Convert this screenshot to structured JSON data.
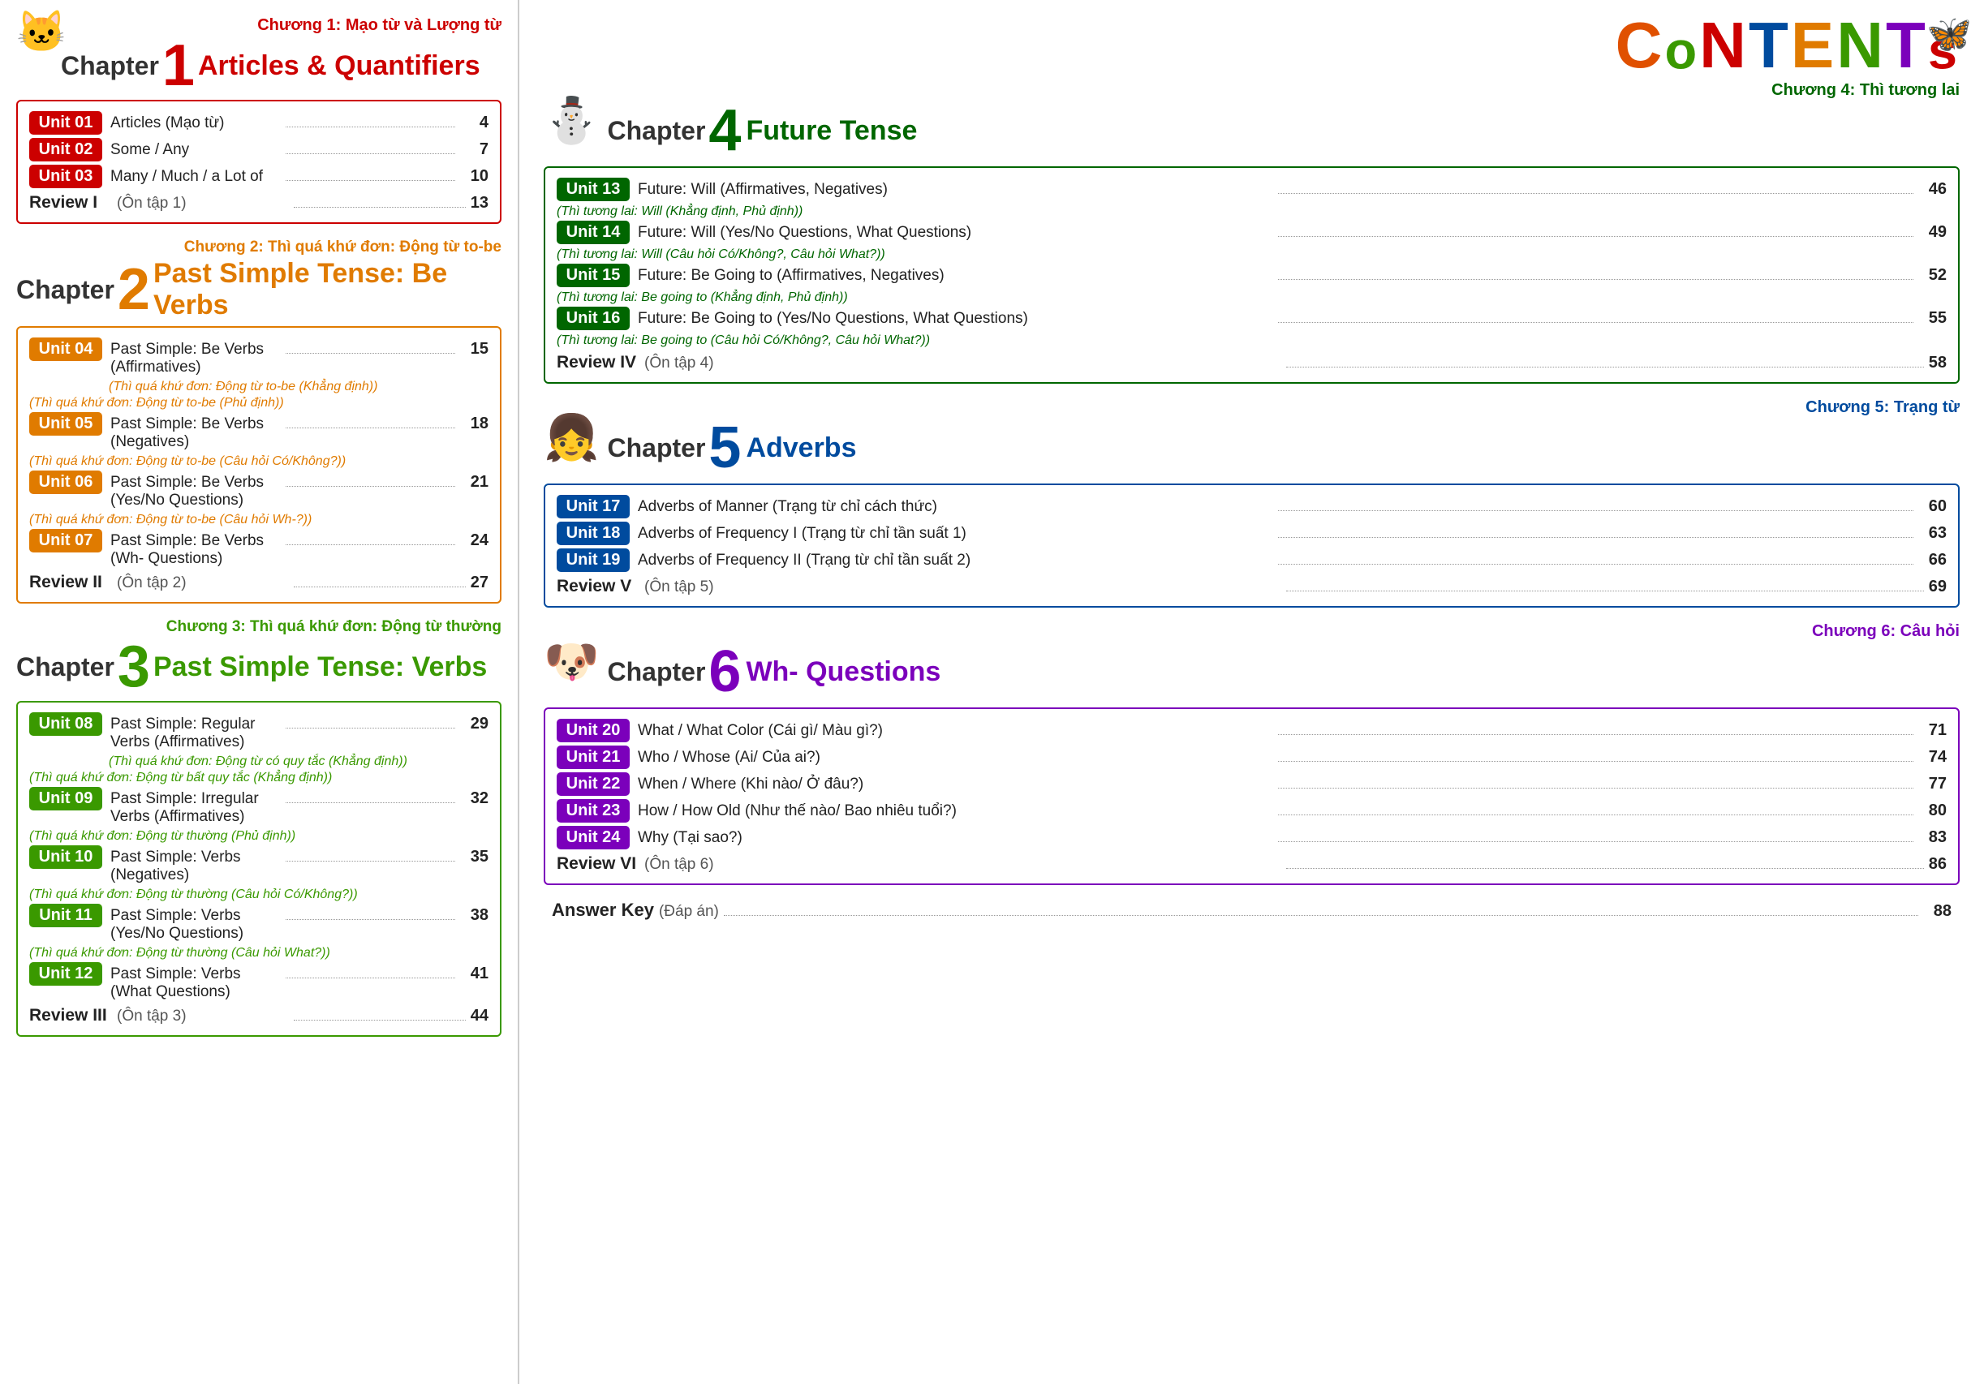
{
  "left": {
    "ch1": {
      "subtitle": "Chương 1: Mạo từ và Lượng từ",
      "num": "1",
      "title": "Articles & Quantifiers",
      "units": [
        {
          "label": "Unit 01",
          "subtitle": null,
          "text": "Articles (Mạo từ)",
          "page": "4"
        },
        {
          "label": "Unit 02",
          "subtitle": null,
          "text": "Some / Any",
          "page": "7"
        },
        {
          "label": "Unit 03",
          "subtitle": null,
          "text": "Many / Much / a Lot of",
          "page": "10"
        }
      ],
      "review": {
        "label": "Review I",
        "text": "(Ôn tập 1)",
        "page": "13"
      }
    },
    "ch2": {
      "subtitle": "Chương 2: Thì quá khứ đơn: Động từ to-be",
      "num": "2",
      "title": "Past Simple Tense: Be Verbs",
      "units": [
        {
          "label": "Unit 04",
          "subtitle": "(Thì quá khứ đơn: Động từ to-be (Khẳng định))",
          "text": "Past Simple: Be Verbs (Affirmatives)",
          "page": "15"
        },
        {
          "label": "Unit 05",
          "subtitle": "(Thì quá khứ đơn: Động từ to-be (Phủ định))",
          "text": "Past Simple: Be Verbs (Negatives)",
          "page": "18"
        },
        {
          "label": "Unit 06",
          "subtitle": "(Thì quá khứ đơn: Động từ to-be (Câu hỏi Có/Không?))",
          "text": "Past Simple: Be Verbs (Yes/No Questions)",
          "page": "21"
        },
        {
          "label": "Unit 07",
          "subtitle": "(Thì quá khứ đơn: Động từ to-be (Câu hỏi Wh-?))",
          "text": "Past Simple: Be Verbs (Wh- Questions)",
          "page": "24"
        }
      ],
      "review": {
        "label": "Review II",
        "text": "(Ôn tập 2)",
        "page": "27"
      }
    },
    "ch3": {
      "subtitle": "Chương 3: Thì quá khứ đơn: Động từ thường",
      "num": "3",
      "title": "Past Simple Tense: Verbs",
      "units": [
        {
          "label": "Unit 08",
          "subtitle": "(Thì quá khứ đơn: Động từ có quy tắc (Khẳng định))",
          "text": "Past Simple: Regular Verbs (Affirmatives)",
          "page": "29"
        },
        {
          "label": "Unit 09",
          "subtitle": "(Thì quá khứ đơn: Động từ bất quy tắc (Khẳng định))",
          "text": "Past Simple: Irregular Verbs (Affirmatives)",
          "page": "32"
        },
        {
          "label": "Unit 10",
          "subtitle": "(Thì quá khứ đơn: Động từ thường (Phủ định))",
          "text": "Past Simple: Verbs (Negatives)",
          "page": "35"
        },
        {
          "label": "Unit 11",
          "subtitle": "(Thì quá khứ đơn: Động từ thường (Câu hỏi Có/Không?))",
          "text": "Past Simple: Verbs (Yes/No Questions)",
          "page": "38"
        },
        {
          "label": "Unit 12",
          "subtitle": "(Thì quá khứ đơn: Động từ thường (Câu hỏi What?))",
          "text": "Past Simple: Verbs (What Questions)",
          "page": "41"
        }
      ],
      "review": {
        "label": "Review III",
        "text": "(Ôn tập 3)",
        "page": "44"
      }
    }
  },
  "right": {
    "contents_letters": [
      "C",
      "o",
      "N",
      "T",
      "E",
      "N",
      "T",
      "s"
    ],
    "ch4": {
      "subtitle": "Chương 4: Thì tương lai",
      "num": "4",
      "title": "Future Tense",
      "units": [
        {
          "label": "Unit 13",
          "subtitle": "(Thì tương lai: Will (Khẳng định, Phủ định))",
          "text": "Future: Will (Affirmatives, Negatives)",
          "page": "46"
        },
        {
          "label": "Unit 14",
          "subtitle": "(Thì tương lai: Will (Câu hỏi Có/Không?, Câu hỏi What?))",
          "text": "Future: Will (Yes/No Questions, What Questions)",
          "page": "49"
        },
        {
          "label": "Unit 15",
          "subtitle": "(Thì tương lai: Be going to (Khẳng định, Phủ định))",
          "text": "Future: Be Going to (Affirmatives, Negatives)",
          "page": "52"
        },
        {
          "label": "Unit 16",
          "subtitle": "(Thì tương lai: Be going to (Câu hỏi Có/Không?, Câu hỏi What?))",
          "text": "Future: Be Going to (Yes/No Questions, What Questions)",
          "page": "55"
        }
      ],
      "review": {
        "label": "Review IV",
        "text": "(Ôn tập 4)",
        "page": "58"
      }
    },
    "ch5": {
      "subtitle": "Chương 5: Trạng từ",
      "num": "5",
      "title": "Adverbs",
      "units": [
        {
          "label": "Unit 17",
          "subtitle": null,
          "text": "Adverbs of Manner  (Trạng từ chỉ cách thức)",
          "page": "60"
        },
        {
          "label": "Unit 18",
          "subtitle": null,
          "text": "Adverbs of Frequency I (Trạng từ chỉ tần suất 1)",
          "page": "63"
        },
        {
          "label": "Unit 19",
          "subtitle": null,
          "text": "Adverbs of Frequency II (Trạng từ chỉ tần suất 2)",
          "page": "66"
        }
      ],
      "review": {
        "label": "Review V",
        "text": "(Ôn tập 5)",
        "page": "69"
      }
    },
    "ch6": {
      "subtitle": "Chương 6: Câu hỏi",
      "num": "6",
      "title": "Wh- Questions",
      "units": [
        {
          "label": "Unit 20",
          "subtitle": null,
          "text": "What / What Color (Cái gì/ Màu gì?)",
          "page": "71"
        },
        {
          "label": "Unit 21",
          "subtitle": null,
          "text": "Who / Whose (Ai/ Của ai?)",
          "page": "74"
        },
        {
          "label": "Unit 22",
          "subtitle": null,
          "text": "When / Where (Khi nào/ Ở đâu?)",
          "page": "77"
        },
        {
          "label": "Unit 23",
          "subtitle": null,
          "text": "How / How Old (Như thế nào/ Bao nhiêu tuổi?)",
          "page": "80"
        },
        {
          "label": "Unit 24",
          "subtitle": null,
          "text": "Why (Tại sao?)",
          "page": "83"
        }
      ],
      "review": {
        "label": "Review VI",
        "text": "(Ôn tập 6)",
        "page": "86"
      }
    },
    "answer_key": {
      "label": "Answer Key",
      "viet": "(Đáp án)",
      "page": "88"
    }
  }
}
